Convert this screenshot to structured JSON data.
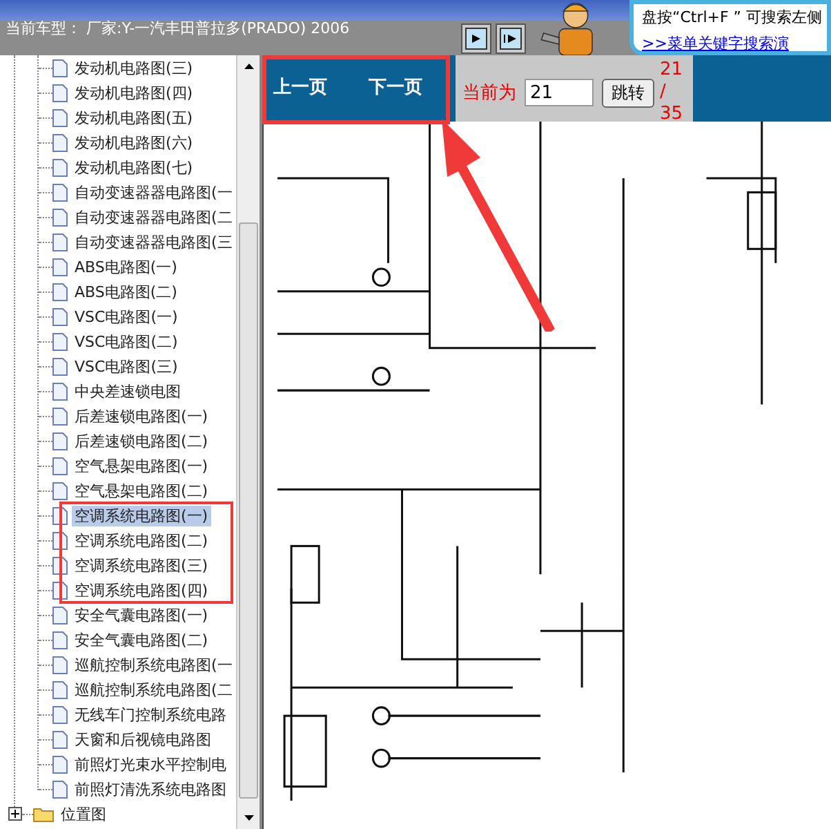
{
  "header": {
    "vehicle": "当前车型： 厂家:Y-一汽丰田普拉多(PRADO) 2006",
    "help_hint": "盘按“Ctrl+F ” 可搜索左侧",
    "help_link": ">>菜单关键字搜索演"
  },
  "tree": {
    "items": [
      {
        "kind": "page",
        "label": "发动机电路图(三)",
        "selected": false
      },
      {
        "kind": "page",
        "label": "发动机电路图(四)",
        "selected": false
      },
      {
        "kind": "page",
        "label": "发动机电路图(五)",
        "selected": false
      },
      {
        "kind": "page",
        "label": "发动机电路图(六)",
        "selected": false
      },
      {
        "kind": "page",
        "label": "发动机电路图(七)",
        "selected": false
      },
      {
        "kind": "page",
        "label": "自动变速器器电路图(一",
        "selected": false
      },
      {
        "kind": "page",
        "label": "自动变速器器电路图(二",
        "selected": false
      },
      {
        "kind": "page",
        "label": "自动变速器器电路图(三",
        "selected": false
      },
      {
        "kind": "page",
        "label": "ABS电路图(一)",
        "selected": false
      },
      {
        "kind": "page",
        "label": "ABS电路图(二)",
        "selected": false
      },
      {
        "kind": "page",
        "label": "VSC电路图(一)",
        "selected": false
      },
      {
        "kind": "page",
        "label": "VSC电路图(二)",
        "selected": false
      },
      {
        "kind": "page",
        "label": "VSC电路图(三)",
        "selected": false
      },
      {
        "kind": "page",
        "label": "中央差速锁电图",
        "selected": false
      },
      {
        "kind": "page",
        "label": "后差速锁电路图(一)",
        "selected": false
      },
      {
        "kind": "page",
        "label": "后差速锁电路图(二)",
        "selected": false
      },
      {
        "kind": "page",
        "label": "空气悬架电路图(一)",
        "selected": false
      },
      {
        "kind": "page",
        "label": "空气悬架电路图(二)",
        "selected": false
      },
      {
        "kind": "page",
        "label": "空调系统电路图(一)",
        "selected": true
      },
      {
        "kind": "page",
        "label": "空调系统电路图(二)",
        "selected": false
      },
      {
        "kind": "page",
        "label": "空调系统电路图(三)",
        "selected": false
      },
      {
        "kind": "page",
        "label": "空调系统电路图(四)",
        "selected": false
      },
      {
        "kind": "page",
        "label": "安全气囊电路图(一)",
        "selected": false
      },
      {
        "kind": "page",
        "label": "安全气囊电路图(二)",
        "selected": false
      },
      {
        "kind": "page",
        "label": "巡航控制系统电路图(一",
        "selected": false
      },
      {
        "kind": "page",
        "label": "巡航控制系统电路图(二",
        "selected": false
      },
      {
        "kind": "page",
        "label": "无线车门控制系统电路",
        "selected": false
      },
      {
        "kind": "page",
        "label": "天窗和后视镜电路图",
        "selected": false
      },
      {
        "kind": "page",
        "label": "前照灯光束水平控制电",
        "selected": false
      },
      {
        "kind": "page",
        "label": "前照灯清洗系统电路图",
        "selected": false
      },
      {
        "kind": "folder",
        "label": "位置图",
        "expanded": false
      }
    ]
  },
  "toolbar": {
    "prev": "上一页",
    "next": "下一页",
    "current_label": "当前为",
    "page_input": "21",
    "go_button": "跳转",
    "page_total": "21 / 35"
  }
}
